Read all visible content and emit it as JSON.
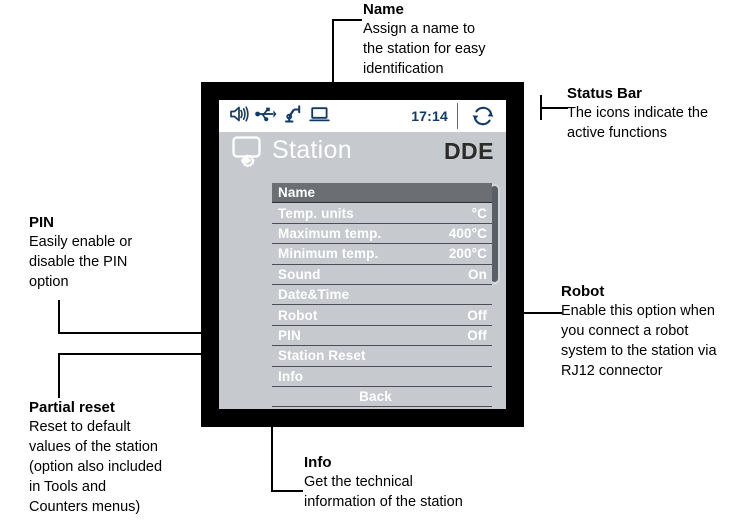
{
  "device": {
    "status_bar": {
      "icons": [
        "speaker-icon",
        "usb-icon",
        "robot-arm-icon",
        "laptop-icon"
      ],
      "time": "17:14",
      "sync_icon": "sync-icon"
    },
    "header": {
      "icon": "station-settings-icon",
      "title": "Station",
      "code": "DDE"
    },
    "menu": [
      {
        "label": "Name",
        "value": "",
        "selected": true
      },
      {
        "label": "Temp. units",
        "value": "°C",
        "selected": false
      },
      {
        "label": "Maximum temp.",
        "value": "400°C",
        "selected": false
      },
      {
        "label": "Minimum temp.",
        "value": "200°C",
        "selected": false
      },
      {
        "label": "Sound",
        "value": "On",
        "selected": false
      },
      {
        "label": "Date&Time",
        "value": "",
        "selected": false
      },
      {
        "label": "Robot",
        "value": "Off",
        "selected": false
      },
      {
        "label": "PIN",
        "value": "Off",
        "selected": false
      },
      {
        "label": "Station Reset",
        "value": "",
        "selected": false
      },
      {
        "label": "Info",
        "value": "",
        "selected": false
      }
    ],
    "back_button": "Back"
  },
  "callouts": {
    "name": {
      "title": "Name",
      "lines": [
        "Assign a name to",
        "the station for easy",
        "identification"
      ]
    },
    "status_bar": {
      "title": "Status Bar",
      "lines": [
        "The icons indicate the",
        "active functions"
      ]
    },
    "robot": {
      "title": "Robot",
      "lines": [
        "Enable this option when",
        "you connect a robot",
        "system to the station via",
        "RJ12 connector"
      ]
    },
    "pin": {
      "title": "PIN",
      "lines": [
        "Easily enable or",
        "disable the PIN",
        "option"
      ]
    },
    "partial_reset": {
      "title": "Partial reset",
      "lines": [
        "Reset to default",
        "values of the station",
        "(option also included",
        "in Tools and",
        "Counters menus)"
      ]
    },
    "info": {
      "title": "Info",
      "lines": [
        "Get the technical",
        "information of the station"
      ]
    }
  },
  "colors": {
    "screen_bg": "#c6cace",
    "selected_row": "#6b6f74",
    "icon_blue": "#123a63",
    "frame": "#000000"
  }
}
